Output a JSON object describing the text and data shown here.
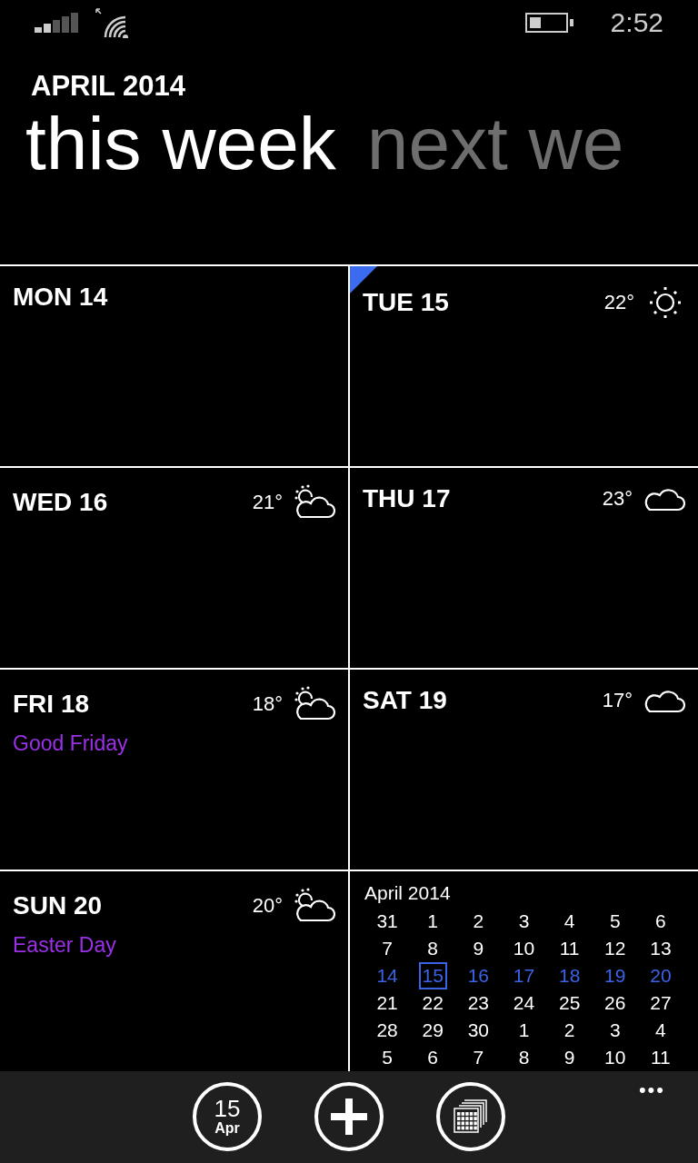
{
  "status_bar": {
    "time": "2:52"
  },
  "header": {
    "month": "APRIL 2014"
  },
  "pivot": [
    {
      "label": "this week",
      "selected": true
    },
    {
      "label": "next we",
      "selected": false
    }
  ],
  "days": [
    {
      "kind": "day",
      "label": "MON 14",
      "today": false
    },
    {
      "kind": "day",
      "label": "TUE 15",
      "today": true,
      "weather": {
        "kind": "sun",
        "temp": "22°"
      }
    },
    {
      "kind": "day",
      "label": "WED 16",
      "today": false,
      "weather": {
        "kind": "partly",
        "temp": "21°"
      }
    },
    {
      "kind": "day",
      "label": "THU 17",
      "today": false,
      "weather": {
        "kind": "cloud",
        "temp": "23°"
      }
    },
    {
      "kind": "day",
      "label": "FRI 18",
      "today": false,
      "weather": {
        "kind": "partly",
        "temp": "18°"
      },
      "event": "Good Friday",
      "color": "#9b30e8"
    },
    {
      "kind": "day",
      "label": "SAT 19",
      "today": false,
      "weather": {
        "kind": "cloud",
        "temp": "17°"
      }
    },
    {
      "kind": "day",
      "label": "SUN 20",
      "today": false,
      "weather": {
        "kind": "partly",
        "temp": "20°"
      },
      "event": "Easter Day",
      "color": "#9b30e8"
    },
    {
      "kind": "month",
      "title": "April 2014",
      "weeks": [
        {
          "current": false,
          "days": [
            {
              "label": "31",
              "selected": false
            },
            {
              "label": "1",
              "selected": false
            },
            {
              "label": "2",
              "selected": false
            },
            {
              "label": "3",
              "selected": false
            },
            {
              "label": "4",
              "selected": false
            },
            {
              "label": "5",
              "selected": false
            },
            {
              "label": "6",
              "selected": false
            }
          ]
        },
        {
          "current": false,
          "days": [
            {
              "label": "7",
              "selected": false
            },
            {
              "label": "8",
              "selected": false
            },
            {
              "label": "9",
              "selected": false
            },
            {
              "label": "10",
              "selected": false
            },
            {
              "label": "11",
              "selected": false
            },
            {
              "label": "12",
              "selected": false
            },
            {
              "label": "13",
              "selected": false
            }
          ]
        },
        {
          "current": true,
          "days": [
            {
              "label": "14",
              "selected": false
            },
            {
              "label": "15",
              "selected": true
            },
            {
              "label": "16",
              "selected": false
            },
            {
              "label": "17",
              "selected": false
            },
            {
              "label": "18",
              "selected": false
            },
            {
              "label": "19",
              "selected": false
            },
            {
              "label": "20",
              "selected": false
            }
          ]
        },
        {
          "current": false,
          "days": [
            {
              "label": "21",
              "selected": false
            },
            {
              "label": "22",
              "selected": false
            },
            {
              "label": "23",
              "selected": false
            },
            {
              "label": "24",
              "selected": false
            },
            {
              "label": "25",
              "selected": false
            },
            {
              "label": "26",
              "selected": false
            },
            {
              "label": "27",
              "selected": false
            }
          ]
        },
        {
          "current": false,
          "days": [
            {
              "label": "28",
              "selected": false
            },
            {
              "label": "29",
              "selected": false
            },
            {
              "label": "30",
              "selected": false
            },
            {
              "label": "1",
              "selected": false
            },
            {
              "label": "2",
              "selected": false
            },
            {
              "label": "3",
              "selected": false
            },
            {
              "label": "4",
              "selected": false
            }
          ]
        },
        {
          "current": false,
          "days": [
            {
              "label": "5",
              "selected": false
            },
            {
              "label": "6",
              "selected": false
            },
            {
              "label": "7",
              "selected": false
            },
            {
              "label": "8",
              "selected": false
            },
            {
              "label": "9",
              "selected": false
            },
            {
              "label": "10",
              "selected": false
            },
            {
              "label": "11",
              "selected": false
            }
          ]
        }
      ]
    }
  ],
  "app_bar": {
    "buttons": [
      {
        "kind": "today",
        "day": "15",
        "month": "Apr"
      },
      {
        "kind": "add"
      },
      {
        "kind": "views"
      }
    ],
    "more": "•••"
  }
}
